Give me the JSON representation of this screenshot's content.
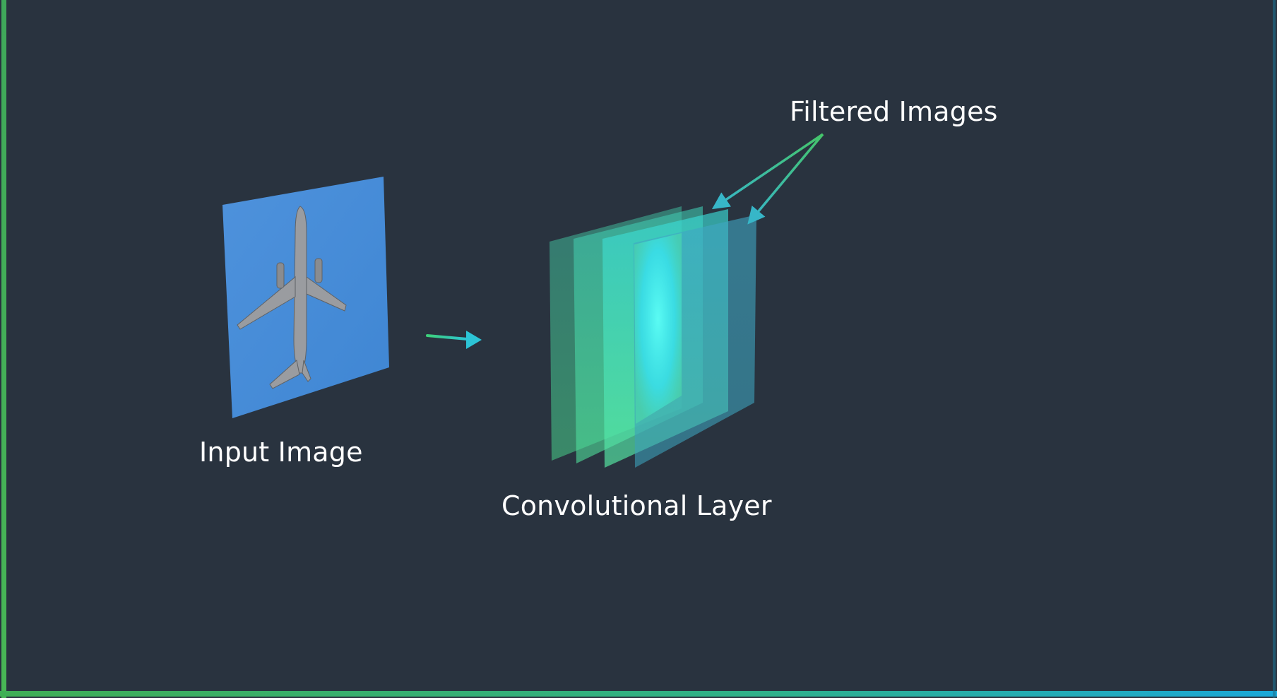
{
  "labels": {
    "input_image": "Input Image",
    "convolutional_layer": "Convolutional Layer",
    "filtered_images": "Filtered Images"
  },
  "colors": {
    "background": "#29333f",
    "frame_left": "#3fae55",
    "frame_bottom_start": "#3fae55",
    "frame_bottom_end": "#1aa7d8",
    "sky_blue": "#4a8fd9",
    "arrow_start": "#3dd17a",
    "arrow_end": "#2cc4d6",
    "layer_core": "#38f0ff",
    "layer_green": "#4ce0a0"
  },
  "icons": {
    "input_picture": "airplane-photo",
    "flow_arrow": "right-arrow-icon",
    "pointer_arrows": "pointer-arrow-icon"
  }
}
